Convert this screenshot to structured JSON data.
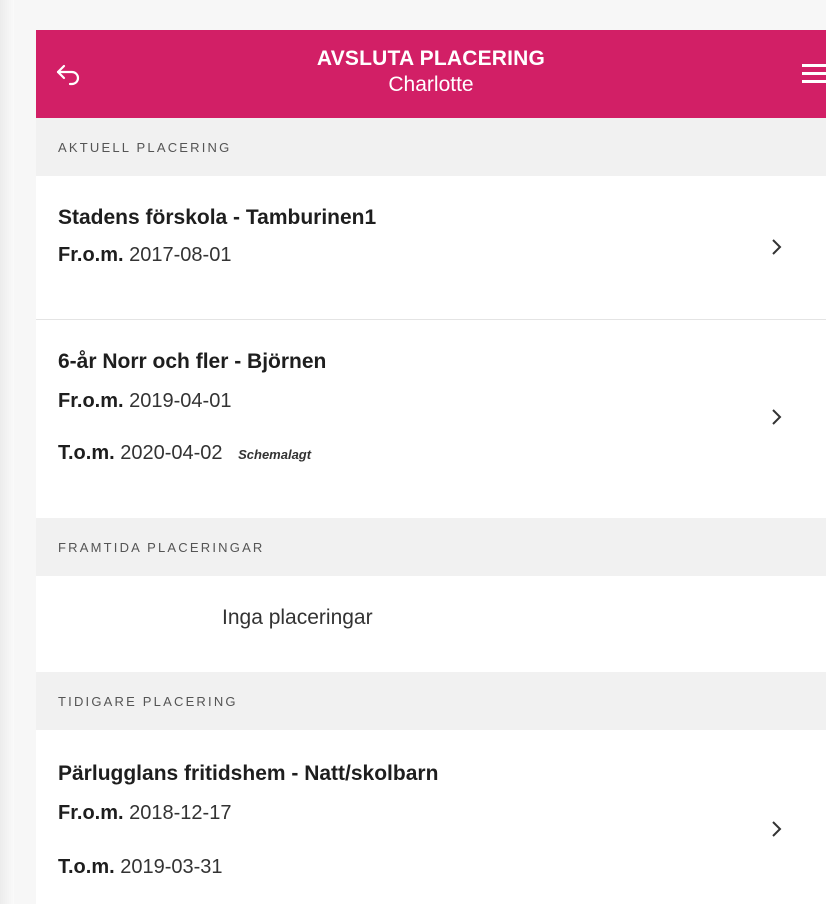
{
  "header": {
    "title": "AVSLUTA PLACERING",
    "subtitle": "Charlotte",
    "back_icon": "back-arrow-icon",
    "menu_icon": "hamburger-menu-icon",
    "color": "#d21f66"
  },
  "sections": {
    "current": {
      "label": "AKTUELL PLACERING",
      "items": [
        {
          "title": "Stadens förskola - Tamburinen1",
          "from_label": "Fr.o.m.",
          "from_date": "2017-08-01"
        },
        {
          "title": "6-år Norr och fler - Björnen",
          "from_label": "Fr.o.m.",
          "from_date": "2019-04-01",
          "to_label": "T.o.m.",
          "to_date": "2020-04-02",
          "tag": "Schemalagt"
        }
      ]
    },
    "future": {
      "label": "FRAMTIDA PLACERINGAR",
      "empty_text": "Inga placeringar"
    },
    "previous": {
      "label": "TIDIGARE PLACERING",
      "items": [
        {
          "title": "Pärlugglans fritidshem - Natt/skolbarn",
          "from_label": "Fr.o.m.",
          "from_date": "2018-12-17",
          "to_label": "T.o.m.",
          "to_date": "2019-03-31"
        }
      ]
    }
  }
}
